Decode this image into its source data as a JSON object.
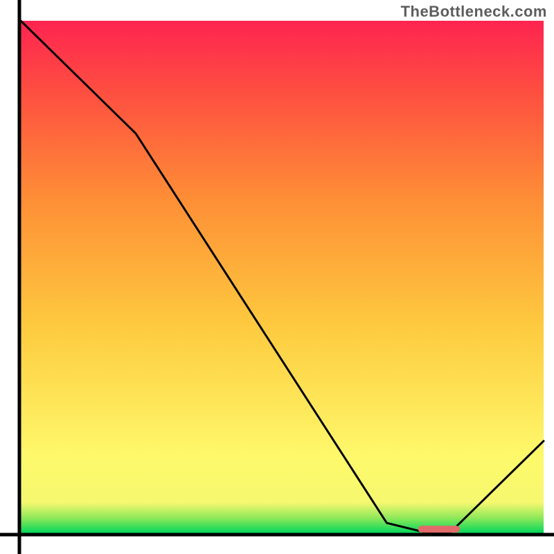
{
  "watermark": "TheBottleneck.com",
  "chart_data": {
    "type": "line",
    "title": "",
    "xlabel": "",
    "ylabel": "",
    "xlim": [
      0,
      100
    ],
    "ylim": [
      0,
      100
    ],
    "series": [
      {
        "name": "bottleneck-curve",
        "x": [
          0,
          22,
          70,
          78,
          82,
          100
        ],
        "y": [
          100,
          78,
          2,
          0,
          0,
          18
        ]
      }
    ],
    "flat_marker": {
      "x_start": 76,
      "x_end": 84,
      "y": 0.8,
      "color": "#e26a6a"
    },
    "gradient_stops": [
      {
        "offset": 0.0,
        "color": "#00d65b"
      },
      {
        "offset": 0.03,
        "color": "#8fe95a"
      },
      {
        "offset": 0.06,
        "color": "#f6f86f"
      },
      {
        "offset": 0.15,
        "color": "#fef96b"
      },
      {
        "offset": 0.4,
        "color": "#fecb3f"
      },
      {
        "offset": 0.65,
        "color": "#fe8f36"
      },
      {
        "offset": 0.85,
        "color": "#fe5240"
      },
      {
        "offset": 1.0,
        "color": "#fe2450"
      }
    ],
    "axes": {
      "color": "#000000",
      "width": 5
    }
  }
}
